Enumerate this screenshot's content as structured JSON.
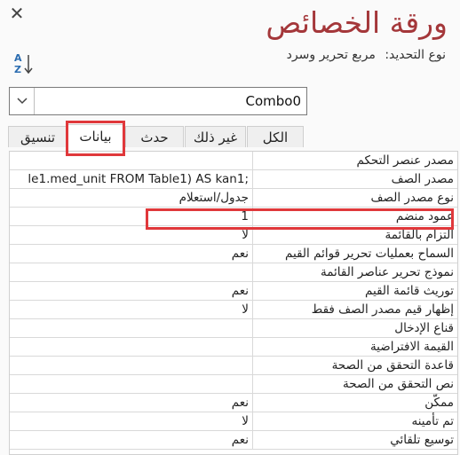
{
  "panel": {
    "title": "ورقة الخصائص",
    "selection_type_label": "نوع التحديد:",
    "selection_type_value": "مربع تحرير وسرد",
    "close_icon": "close-icon",
    "sort_icon": "sort-az-icon"
  },
  "object_selector": {
    "value": "Combo0"
  },
  "tabs": [
    {
      "label": "الكل"
    },
    {
      "label": "غير ذلك"
    },
    {
      "label": "حدث"
    },
    {
      "label": "بيانات"
    },
    {
      "label": "تنسيق"
    }
  ],
  "active_tab": "بيانات",
  "properties": [
    {
      "label": "مصدر عنصر التحكم",
      "value": ""
    },
    {
      "label": "مصدر الصف",
      "value": "le1.med_unit FROM Table1) AS kan1;"
    },
    {
      "label": "نوع مصدر الصف",
      "value": "جدول/استعلام"
    },
    {
      "label": "عمود منضم",
      "value": "1"
    },
    {
      "label": "التزام بالقائمة",
      "value": "لا"
    },
    {
      "label": "السماح بعمليات تحرير قوائم القيم",
      "value": "نعم"
    },
    {
      "label": "نموذج تحرير عناصر القائمة",
      "value": ""
    },
    {
      "label": "توريث قائمة القيم",
      "value": "نعم"
    },
    {
      "label": "إظهار قيم مصدر الصف فقط",
      "value": "لا"
    },
    {
      "label": "قناع الإدخال",
      "value": ""
    },
    {
      "label": "القيمة الافتراضية",
      "value": ""
    },
    {
      "label": "قاعدة التحقق من الصحة",
      "value": ""
    },
    {
      "label": "نص التحقق من الصحة",
      "value": ""
    },
    {
      "label": "ممكّن",
      "value": "نعم"
    },
    {
      "label": "تم تأمينه",
      "value": "لا"
    },
    {
      "label": "توسيع تلقائي",
      "value": "نعم"
    }
  ],
  "colors": {
    "title": "#a4373a",
    "highlight": "#e0383b"
  }
}
